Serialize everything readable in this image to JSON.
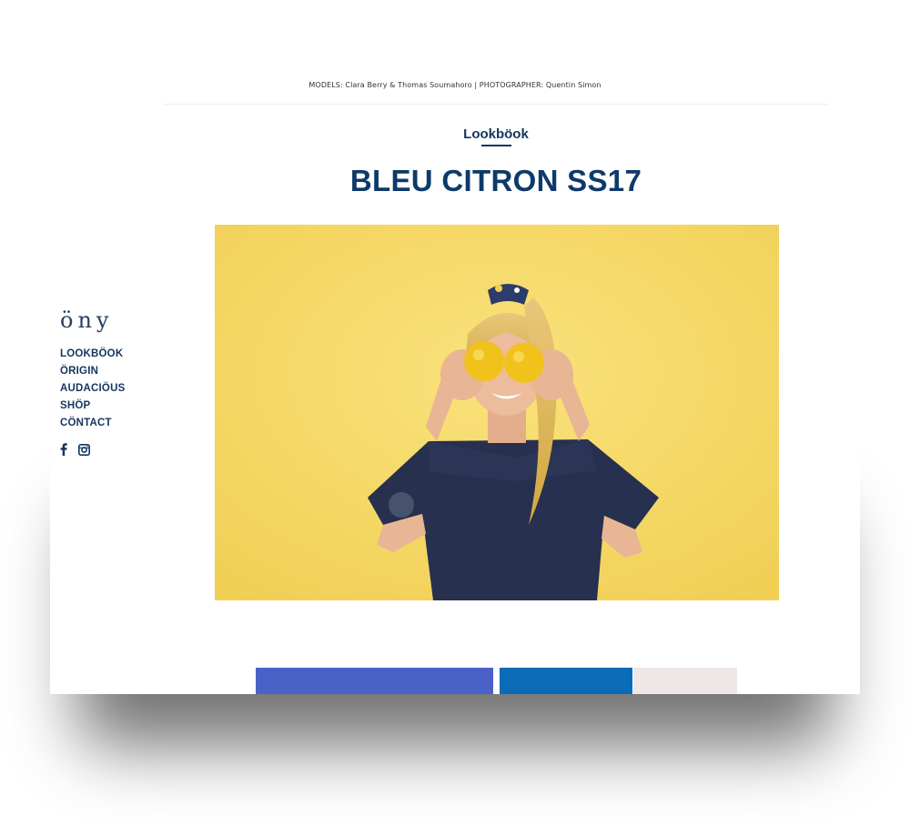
{
  "credits": "MODELS: Clara Berry & Thomas Soumahoro | PHOTOGRAPHER: Quentin Simon",
  "section_label": "Lookböok",
  "page_title": "BLEU CITRON SS17",
  "logo": "öny",
  "nav": [
    {
      "label": "LOOKBÖOK"
    },
    {
      "label": "ÖRIGIN"
    },
    {
      "label": "AUDACIÖUS"
    },
    {
      "label": "SHÖP"
    },
    {
      "label": "CÖNTACT"
    }
  ],
  "social": {
    "facebook": "facebook-icon",
    "instagram": "instagram-icon"
  },
  "colors": {
    "navy": "#14355f",
    "title": "#0d3a6a",
    "hero_bg": "#f6d86a",
    "swatch_1": "#4a62c8",
    "swatch_2": "#0a6bb6",
    "swatch_3": "#ede8e6"
  }
}
